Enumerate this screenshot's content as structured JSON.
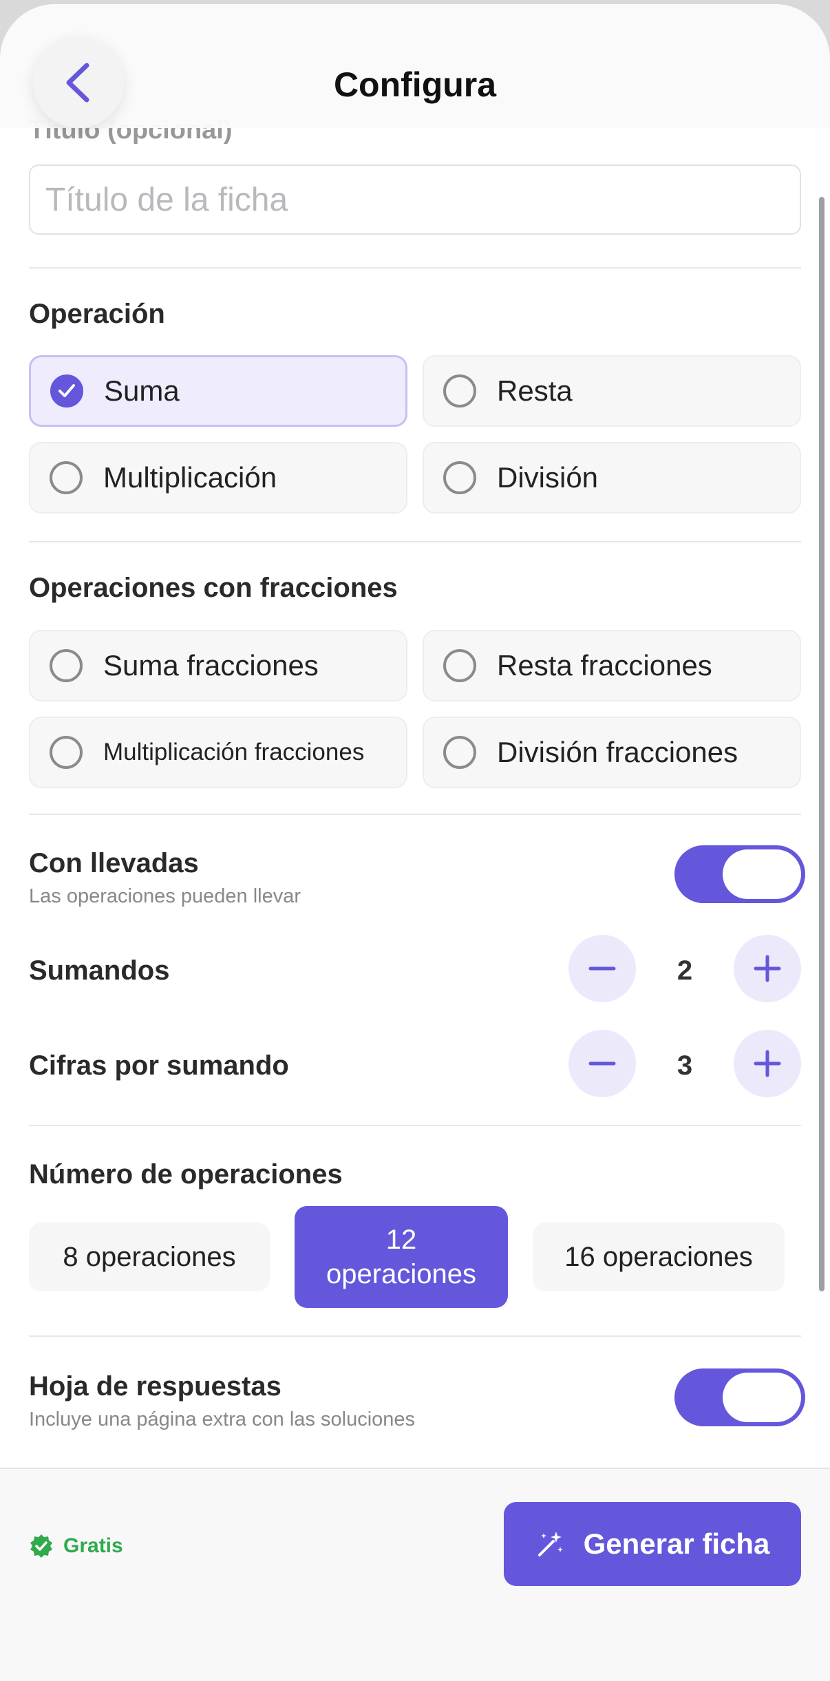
{
  "header": {
    "title": "Configura",
    "back_icon": "chevron-left-icon"
  },
  "title_field": {
    "label": "Título (opcional)",
    "placeholder": "Título de la ficha",
    "value": ""
  },
  "operation": {
    "title": "Operación",
    "options": [
      {
        "label": "Suma",
        "selected": true
      },
      {
        "label": "Resta",
        "selected": false
      },
      {
        "label": "Multiplicación",
        "selected": false
      },
      {
        "label": "División",
        "selected": false
      }
    ]
  },
  "fractions": {
    "title": "Operaciones con fracciones",
    "options": [
      {
        "label": "Suma fracciones",
        "selected": false
      },
      {
        "label": "Resta fracciones",
        "selected": false
      },
      {
        "label": "Multiplicación fracciones",
        "selected": false
      },
      {
        "label": "División fracciones",
        "selected": false
      }
    ]
  },
  "carry": {
    "title": "Con llevadas",
    "subtitle": "Las operaciones pueden llevar",
    "enabled": true
  },
  "addends": {
    "title": "Sumandos",
    "value": "2"
  },
  "digits": {
    "title": "Cifras por sumando",
    "value": "3"
  },
  "count": {
    "title": "Número de operaciones",
    "options": [
      {
        "label": "8 operaciones",
        "selected": false
      },
      {
        "label": "12 operaciones",
        "selected": true
      },
      {
        "label": "16 operaciones",
        "selected": false
      }
    ]
  },
  "answers": {
    "title": "Hoja de respuestas",
    "subtitle": "Incluye una página extra con las soluciones",
    "enabled": true
  },
  "footer": {
    "badge": "Gratis",
    "button": "Generar ficha"
  },
  "colors": {
    "accent": "#6457dc",
    "accent_light": "#ece9fb",
    "success": "#2faa4c"
  }
}
